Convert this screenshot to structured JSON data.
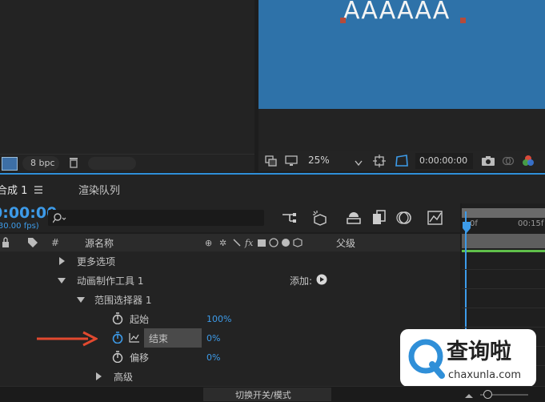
{
  "project_panel": {
    "bpc_label": "8 bpc"
  },
  "viewer": {
    "canvas_text": "AAAAAA",
    "zoom": "25%",
    "timecode": "0:00:00:00"
  },
  "timeline": {
    "tab_comp": "合成 1",
    "tab_render": "渲染队列",
    "time": "0:00:00",
    "fps": "(30.00 fps)",
    "search_placeholder": "",
    "columns": {
      "hash": "#",
      "source_name": "源名称",
      "parent": "父级"
    },
    "ruler": {
      "start": "0f",
      "mark": "00:15f"
    },
    "rows": [
      {
        "label": "更多选项"
      },
      {
        "label": "动画制作工具 1",
        "add_label": "添加:"
      },
      {
        "label": "范围选择器 1"
      },
      {
        "label": "起始",
        "value": "100%"
      },
      {
        "label": "结束",
        "value": "0%"
      },
      {
        "label": "偏移",
        "value": "0%"
      },
      {
        "label": "高级"
      }
    ],
    "toggle_label": "切换开关/模式"
  },
  "watermark": {
    "brand": "查询啦",
    "url": "chaxunla.com"
  },
  "colors": {
    "accent": "#2f8fd8",
    "canvas": "#2e72a9",
    "value_blue": "#3d9be9",
    "arrow": "#e2492f",
    "watermark_blue": "#2f8fd8"
  }
}
